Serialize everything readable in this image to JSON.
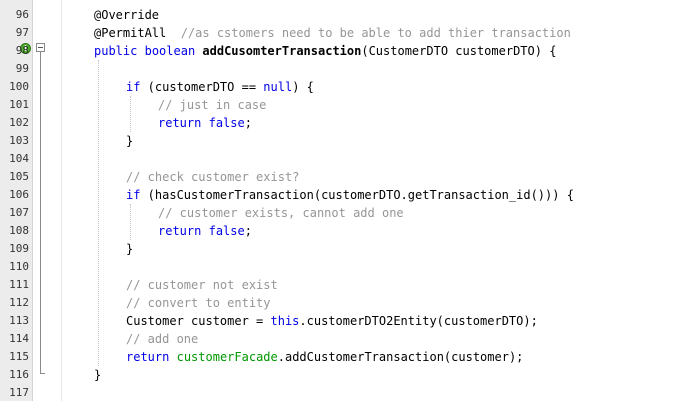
{
  "editor": {
    "lines": [
      {
        "number": "96",
        "indent": 0,
        "tokens": [
          {
            "text": "@Override",
            "type": "ann"
          }
        ]
      },
      {
        "number": "97",
        "indent": 0,
        "tokens": [
          {
            "text": "@PermitAll",
            "type": "ann"
          },
          {
            "text": "  ",
            "type": "plain"
          },
          {
            "text": "//as cstomers need to be able to add thier transaction",
            "type": "com"
          }
        ]
      },
      {
        "number": "98",
        "indent": 0,
        "tokens": [
          {
            "text": "public",
            "type": "kw"
          },
          {
            "text": " ",
            "type": "plain"
          },
          {
            "text": "boolean",
            "type": "kw"
          },
          {
            "text": " ",
            "type": "plain"
          },
          {
            "text": "addCusomterTransaction",
            "type": "fn"
          },
          {
            "text": "(CustomerDTO customerDTO) {",
            "type": "plain"
          }
        ]
      },
      {
        "number": "99",
        "indent": 0,
        "tokens": []
      },
      {
        "number": "100",
        "indent": 1,
        "tokens": [
          {
            "text": "if",
            "type": "kw"
          },
          {
            "text": " (customerDTO == ",
            "type": "plain"
          },
          {
            "text": "null",
            "type": "kw"
          },
          {
            "text": ") {",
            "type": "plain"
          }
        ]
      },
      {
        "number": "101",
        "indent": 2,
        "tokens": [
          {
            "text": "// just in case",
            "type": "com"
          }
        ]
      },
      {
        "number": "102",
        "indent": 2,
        "tokens": [
          {
            "text": "return",
            "type": "kw"
          },
          {
            "text": " ",
            "type": "plain"
          },
          {
            "text": "false",
            "type": "kw"
          },
          {
            "text": ";",
            "type": "plain"
          }
        ]
      },
      {
        "number": "103",
        "indent": 1,
        "tokens": [
          {
            "text": "}",
            "type": "plain"
          }
        ]
      },
      {
        "number": "104",
        "indent": 0,
        "tokens": []
      },
      {
        "number": "105",
        "indent": 1,
        "tokens": [
          {
            "text": "// check customer exist?",
            "type": "com"
          }
        ]
      },
      {
        "number": "106",
        "indent": 1,
        "tokens": [
          {
            "text": "if",
            "type": "kw"
          },
          {
            "text": " (hasCustomerTransaction(customerDTO.getTransaction_id())) {",
            "type": "plain"
          }
        ]
      },
      {
        "number": "107",
        "indent": 2,
        "tokens": [
          {
            "text": "// customer exists, cannot add one",
            "type": "com"
          }
        ]
      },
      {
        "number": "108",
        "indent": 2,
        "tokens": [
          {
            "text": "return",
            "type": "kw"
          },
          {
            "text": " ",
            "type": "plain"
          },
          {
            "text": "false",
            "type": "kw"
          },
          {
            "text": ";",
            "type": "plain"
          }
        ]
      },
      {
        "number": "109",
        "indent": 1,
        "tokens": [
          {
            "text": "}",
            "type": "plain"
          }
        ]
      },
      {
        "number": "110",
        "indent": 0,
        "tokens": []
      },
      {
        "number": "111",
        "indent": 1,
        "tokens": [
          {
            "text": "// customer not exist",
            "type": "com"
          }
        ]
      },
      {
        "number": "112",
        "indent": 1,
        "tokens": [
          {
            "text": "// convert to entity",
            "type": "com"
          }
        ]
      },
      {
        "number": "113",
        "indent": 1,
        "tokens": [
          {
            "text": "Customer customer = ",
            "type": "plain"
          },
          {
            "text": "this",
            "type": "this"
          },
          {
            "text": ".customerDTO2Entity(customerDTO);",
            "type": "plain"
          }
        ]
      },
      {
        "number": "114",
        "indent": 1,
        "tokens": [
          {
            "text": "// add one",
            "type": "com"
          }
        ]
      },
      {
        "number": "115",
        "indent": 1,
        "tokens": [
          {
            "text": "return",
            "type": "kw"
          },
          {
            "text": " ",
            "type": "plain"
          },
          {
            "text": "customerFacade",
            "type": "field"
          },
          {
            "text": ".addCustomerTransaction(customer);",
            "type": "plain"
          }
        ]
      },
      {
        "number": "116",
        "indent": 0,
        "tokens": [
          {
            "text": "}",
            "type": "plain"
          }
        ]
      },
      {
        "number": "117",
        "indent": 0,
        "tokens": []
      }
    ]
  },
  "icons": {
    "override_marker": "override-annotation-icon",
    "fold_toggle": "fold-collapse-icon"
  },
  "colors": {
    "keyword": "#0000e6",
    "comment": "#969696",
    "field": "#009900",
    "gutter_bg": "#ececec"
  }
}
